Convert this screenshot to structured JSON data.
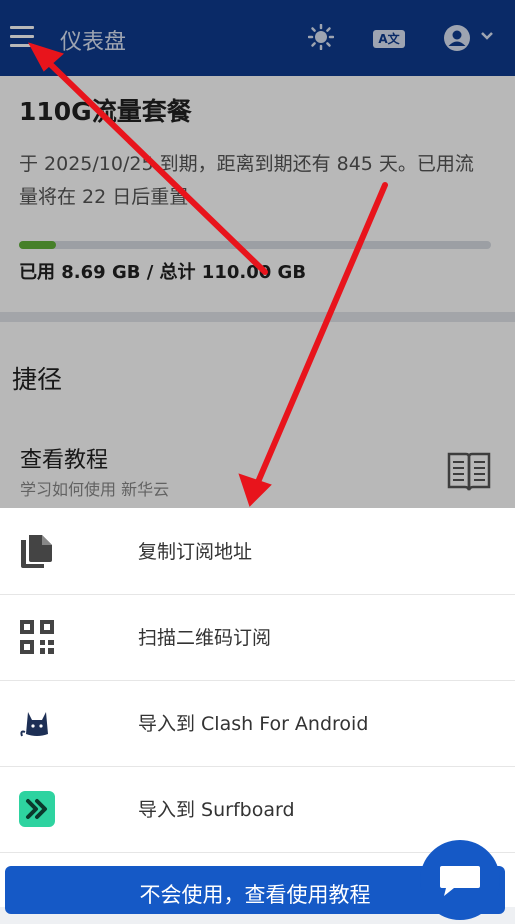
{
  "header": {
    "title": "仪表盘",
    "menu_icon": "menu-icon",
    "theme_icon": "sun-icon",
    "translate_icon": "translate-icon",
    "translate_text": "A文",
    "user_icon": "user-circle-icon",
    "chevron": "˅"
  },
  "plan": {
    "name": "110G流量套餐",
    "description": "于 2025/10/25 到期，距离到期还有 845 天。已用流量将在 22 日后重置",
    "usage_fraction": 0.079,
    "usage_text": "已用 8.69 GB / 总计 110.00 GB"
  },
  "shortcuts": {
    "heading": "捷径",
    "tutorial": {
      "title": "查看教程",
      "subtitle": "学习如何使用 新华云",
      "icon": "book-icon"
    }
  },
  "sheet": {
    "items": [
      {
        "label": "复制订阅地址",
        "icon": "copy-icon"
      },
      {
        "label": "扫描二维码订阅",
        "icon": "qrcode-icon"
      },
      {
        "label": "导入到 Clash For Android",
        "icon": "clash-cat-icon"
      },
      {
        "label": "导入到 Surfboard",
        "icon": "surfboard-icon"
      }
    ],
    "help_button": "不会使用，查看使用教程"
  },
  "colors": {
    "header_bg": "#0e3b8f",
    "primary": "#1559c6",
    "progress": "#62b23a",
    "annotation_arrow": "#e8141c"
  }
}
